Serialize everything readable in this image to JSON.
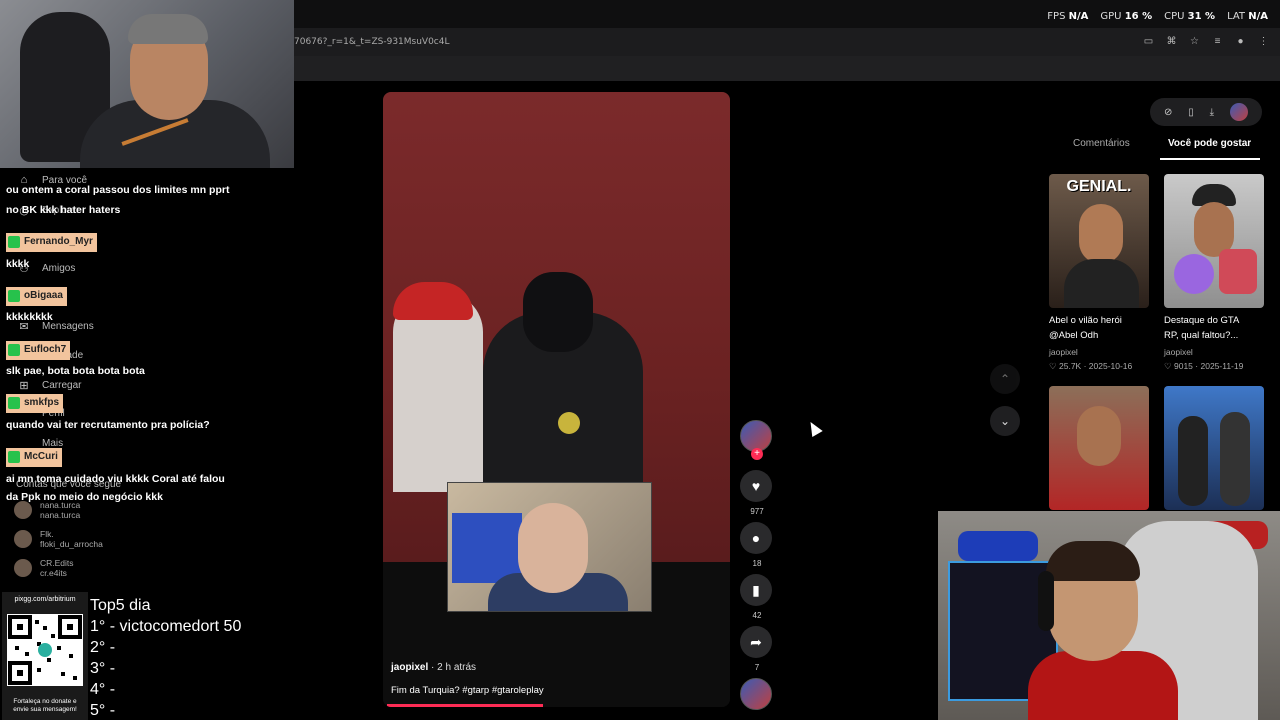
{
  "stats": {
    "fps_label": "FPS",
    "fps_value": "N/A",
    "gpu_label": "GPU",
    "gpu_value": "16 %",
    "cpu_label": "CPU",
    "cpu_value": "31 %",
    "lat_label": "LAT",
    "lat_value": "N/A"
  },
  "browser": {
    "url": "70676?_r=1&_t=ZS-931MsuV0c4L"
  },
  "sidebar": {
    "items": [
      "Para você",
      "Explorar",
      "Amigos",
      "Mensagens",
      "Atividade",
      "Carregar",
      "Perfil",
      "Mais"
    ],
    "following_title": "Contas que você segue",
    "following": [
      {
        "name": "nana.turca",
        "handle": "nana.turca"
      },
      {
        "name": "Flk.",
        "handle": "floki_du_arrocha"
      },
      {
        "name": "CR.Edits",
        "handle": "cr.e4its"
      }
    ]
  },
  "chat": {
    "messages": [
      {
        "user": "",
        "text": "ou ontem a coral passou dos limites mn pprt"
      },
      {
        "user": "",
        "text": "no BK kkk hater haters"
      },
      {
        "user": "Fernando_Myr",
        "text": "kkkk"
      },
      {
        "user": "oBigaaa",
        "text": "kkkkkkkk"
      },
      {
        "user": "Eufloch7",
        "text": "slk pae, bota bota bota bota"
      },
      {
        "user": "smkfps",
        "text": "quando vai ter recrutamento pra polícia?"
      },
      {
        "user": "McCuri",
        "text": "ai mn toma cuidado viu kkkk Coral até falou"
      },
      {
        "user": "",
        "text": "da Ppk no meio do negócio kkk"
      }
    ]
  },
  "donation": {
    "url": "pixgg.com/arbitrium",
    "footer_line1": "Fortaleça no donate e",
    "footer_line2": "envie sua mensagem!"
  },
  "top5": {
    "title": "Top5 dia",
    "rows": [
      "1° - victocomedort 50",
      "2° -",
      "3° -",
      "4° -",
      "5° -"
    ]
  },
  "video": {
    "author": "jaopixel",
    "time": "· 2 h atrás",
    "caption": "Fim da Turquia? #gtarp #gtaroleplay",
    "progress": 0.45
  },
  "actions": {
    "likes": "977",
    "comments": "18",
    "saves": "42",
    "shares": "7"
  },
  "panel": {
    "tab_comments": "Comentários",
    "tab_suggest": "Você pode gostar",
    "cards": [
      {
        "overlay": "GENIAL.",
        "title": "Abel o vilão herói",
        "subtitle": "@Abel Odh",
        "author": "jaopixel",
        "likes": "25.7K",
        "date": "2025-10-16"
      },
      {
        "overlay": "",
        "title": "Destaque do GTA",
        "subtitle": "RP, qual faltou?...",
        "author": "jaopixel",
        "likes": "9015",
        "date": "2025-11-19"
      },
      {
        "overlay": "",
        "title": "",
        "subtitle": "",
        "author": "",
        "likes": "",
        "date": ""
      },
      {
        "overlay": "",
        "title": "",
        "subtitle": "",
        "author": "",
        "likes": "",
        "date": ""
      }
    ]
  },
  "colors": {
    "accent": "#fe2c55",
    "chat_name_bg": "#f2c49d",
    "chat_badge": "#27c24c"
  }
}
